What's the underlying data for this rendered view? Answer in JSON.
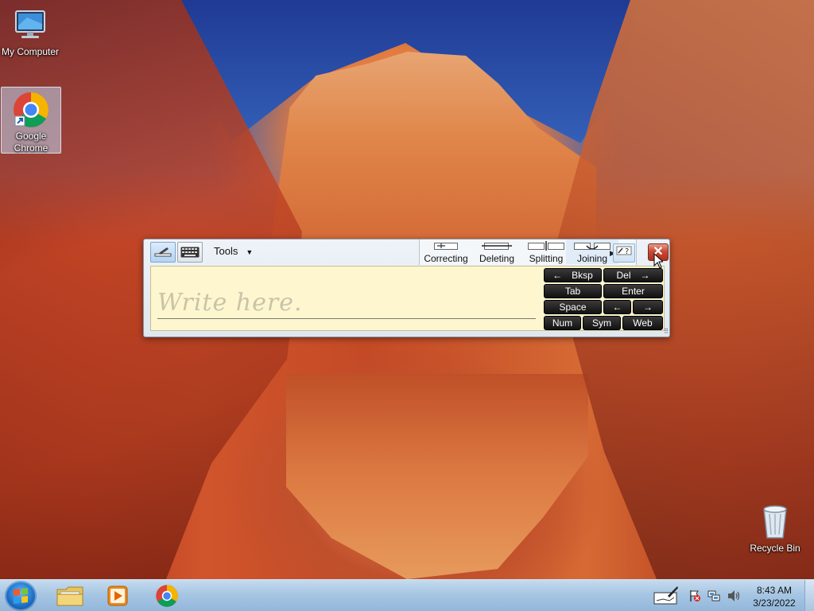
{
  "desktop": {
    "icons": [
      {
        "label": "My Computer"
      },
      {
        "label": "Google\nChrome"
      },
      {
        "label": "Recycle Bin"
      }
    ]
  },
  "input_panel": {
    "tools_label": "Tools",
    "gestures": [
      {
        "label": "Correcting"
      },
      {
        "label": "Deleting"
      },
      {
        "label": "Splitting"
      },
      {
        "label": "Joining"
      }
    ],
    "write_hint": "Write here.",
    "keys": {
      "bksp": "Bksp",
      "del": "Del",
      "tab": "Tab",
      "enter": "Enter",
      "space": "Space",
      "num": "Num",
      "sym": "Sym",
      "web": "Web",
      "left_arrow": "←",
      "right_arrow": "→"
    },
    "close_glyph": "✕"
  },
  "taskbar": {
    "time": "8:43 AM",
    "date": "3/23/2022"
  },
  "colors": {
    "taskbar": "#a7c6e3",
    "writing_pad": "#fdf6cf",
    "close_button": "#c84a34",
    "key": "#1a1a1a"
  },
  "icons": {
    "computer": "computer-icon",
    "chrome": "chrome-icon",
    "recycle": "recycle-bin-icon",
    "pen": "pen-icon",
    "keyboard": "keyboard-icon",
    "help": "help-icon",
    "start": "start-orb-icon",
    "explorer": "folder-icon",
    "media": "media-player-icon",
    "tablet": "tablet-input-icon",
    "action_center": "action-center-icon",
    "network": "network-icon",
    "volume": "volume-icon"
  }
}
